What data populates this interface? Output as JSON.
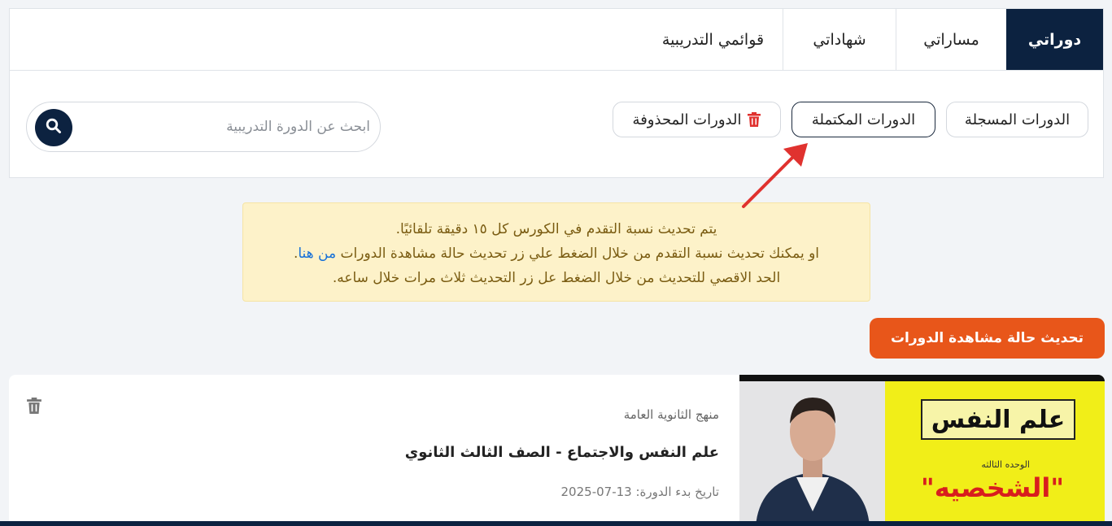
{
  "tabs": [
    {
      "label": "دوراتي",
      "active": true
    },
    {
      "label": "مساراتي",
      "active": false
    },
    {
      "label": "شهاداتي",
      "active": false
    },
    {
      "label": "قوائمي التدريبية",
      "active": false
    }
  ],
  "filters": {
    "registered": "الدورات المسجلة",
    "completed": "الدورات المكتملة",
    "deleted": "الدورات المحذوفة"
  },
  "search": {
    "placeholder": "ابحث عن الدورة التدريبية"
  },
  "notice": {
    "line1": "يتم تحديث نسبة التقدم في الكورس كل ١٥ دقيقة تلقائيًا.",
    "line2": "او يمكنك تحديث نسبة التقدم من خلال الضغط علي زر تحديث حالة مشاهدة الدورات",
    "link": "من هنا",
    "line2_end": ".",
    "line3": "الحد الاقصي للتحديث من خلال الضغط عل زر التحديث ثلاث مرات خلال ساعه."
  },
  "refresh_button": "تحديث حالة مشاهدة الدورات",
  "course": {
    "category": "منهج الثانوية العامة",
    "title": "علم النفس والاجتماع - الصف الثالث الثانوي",
    "start_date_label": "تاريخ بدء الدورة:",
    "start_date": "13-07-2025",
    "thumb_sign": "علم النفس",
    "thumb_unit": "الوحده الثالثه",
    "thumb_word": "\"الشخصيه\""
  },
  "colors": {
    "navy": "#0c2240",
    "orange": "#e8561a",
    "arrow": "#e0322f"
  }
}
